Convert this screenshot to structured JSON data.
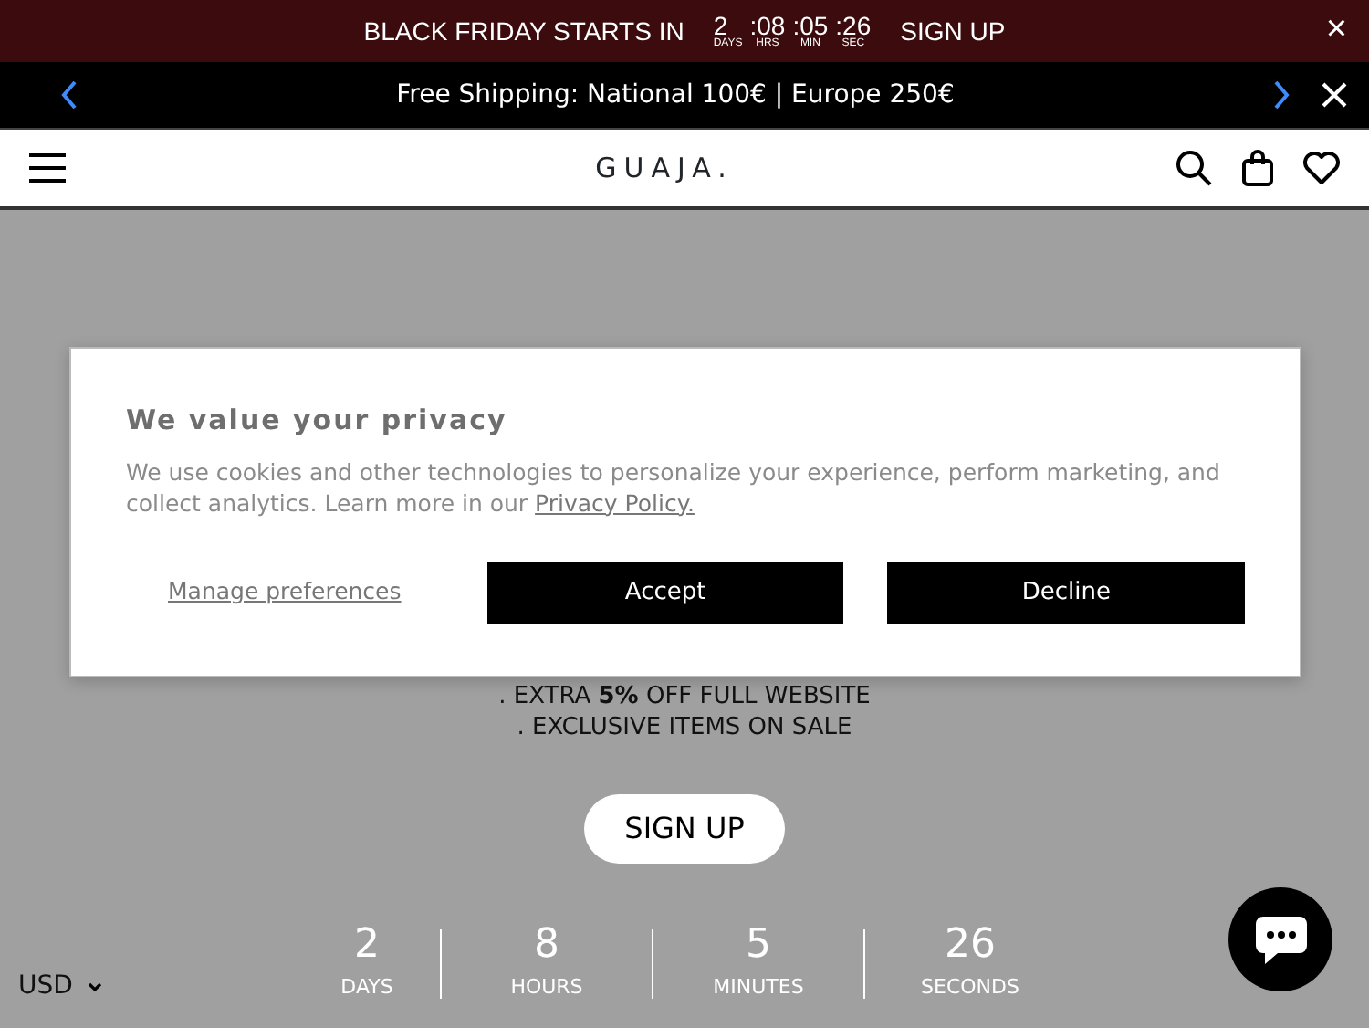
{
  "promo_bar": {
    "text": "BLACK FRIDAY STARTS IN",
    "countdown": [
      {
        "value": "2",
        "unit": "DAYS"
      },
      {
        "value": ":08",
        "unit": "HRS"
      },
      {
        "value": ":05",
        "unit": "MIN"
      },
      {
        "value": ":26",
        "unit": "SEC"
      }
    ],
    "button": "SIGN UP",
    "close": "×"
  },
  "announcement_bar": {
    "text": "Free Shipping: National 100€ | Europe 250€"
  },
  "header": {
    "logo": "GUAJA."
  },
  "offer_lines": [
    ". EXTRA **5%** OFF FULL WEBSITE",
    ". EXCLUSIVE ITEMS ON SALE"
  ],
  "signup_button": "SIGN UP",
  "countdown": [
    {
      "value": "2",
      "unit": "DAYS"
    },
    {
      "value": "8",
      "unit": "HOURS"
    },
    {
      "value": "5",
      "unit": "MINUTES"
    },
    {
      "value": "26",
      "unit": "SECONDS"
    }
  ],
  "currency": "USD",
  "cookie_dialog": {
    "title": "We value your privacy",
    "text": "We use cookies and other technologies to personalize your experience, perform marketing, and collect analytics. Learn more in our",
    "link": "Privacy Policy.",
    "manage": "Manage preferences",
    "accept": "Accept",
    "decline": "Decline"
  }
}
